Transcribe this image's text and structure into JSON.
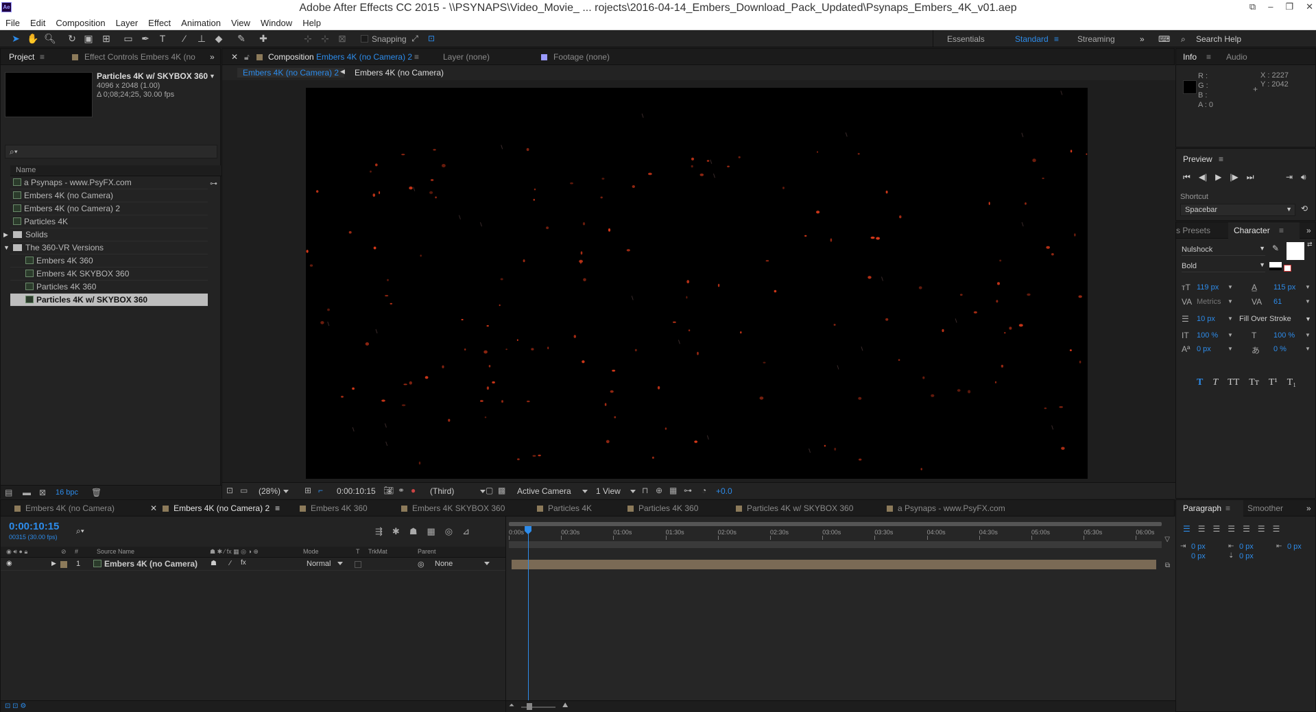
{
  "app": {
    "title": "Adobe After Effects CC 2015 - \\\\PSYNAPS\\Video_Movie_ ... rojects\\2016-04-14_Embers_Download_Pack_Updated\\Psynaps_Embers_4K_v01.aep",
    "logo": "Ae"
  },
  "menu": [
    "File",
    "Edit",
    "Composition",
    "Layer",
    "Effect",
    "Animation",
    "View",
    "Window",
    "Help"
  ],
  "toolbar": {
    "snapping_label": "Snapping",
    "workspaces": [
      "Essentials",
      "Standard",
      "Streaming"
    ],
    "active_workspace": "Standard",
    "search_help": "Search Help"
  },
  "project": {
    "tab": "Project",
    "effect_controls_tab": "Effect Controls Embers 4K (no",
    "selected_name": "Particles 4K w/ SKYBOX 360",
    "selected_dims": "4096 x 2048 (1.00)",
    "selected_duration": "Δ 0;08;24;25, 30.00 fps",
    "search_placeholder": "",
    "name_header": "Name",
    "items": [
      {
        "label": "a Psynaps - www.PsyFX.com",
        "type": "comp",
        "indent": 0
      },
      {
        "label": "Embers 4K (no Camera)",
        "type": "comp",
        "indent": 0
      },
      {
        "label": "Embers 4K (no Camera) 2",
        "type": "comp",
        "indent": 0
      },
      {
        "label": "Particles 4K",
        "type": "comp",
        "indent": 0
      },
      {
        "label": "Solids",
        "type": "folder",
        "indent": 0,
        "expanded": false
      },
      {
        "label": "The 360-VR Versions",
        "type": "folder",
        "indent": 0,
        "expanded": true
      },
      {
        "label": "Embers 4K 360",
        "type": "comp",
        "indent": 1
      },
      {
        "label": "Embers 4K SKYBOX 360",
        "type": "comp",
        "indent": 1
      },
      {
        "label": "Particles 4K 360",
        "type": "comp",
        "indent": 1
      },
      {
        "label": "Particles 4K w/ SKYBOX 360",
        "type": "comp",
        "indent": 1,
        "selected": true
      }
    ],
    "bpc": "16 bpc"
  },
  "composition": {
    "tab_prefix": "Composition",
    "tab_name": "Embers 4K (no Camera) 2",
    "layer_tab": "Layer (none)",
    "footage_tab": "Footage (none)",
    "breadcrumb": [
      "Embers 4K (no Camera) 2",
      "Embers 4K (no Camera)"
    ],
    "zoom": "(28%)",
    "timecode": "0:00:10:15",
    "resolution": "(Third)",
    "camera": "Active Camera",
    "views": "1 View",
    "exposure": "+0.0"
  },
  "info": {
    "tab": "Info",
    "audio_tab": "Audio",
    "r": "R :",
    "g": "G :",
    "b": "B :",
    "a": "A : 0",
    "x": "X : 2227",
    "y": "Y : 2042"
  },
  "preview": {
    "title": "Preview",
    "shortcut_label": "Shortcut",
    "shortcut_value": "Spacebar"
  },
  "character": {
    "presets_tab": "s Presets",
    "tab": "Character",
    "font": "Nulshock",
    "style": "Bold",
    "size": "119 px",
    "leading": "115 px",
    "kerning": "Metrics",
    "tracking": "61",
    "stroke_width": "10 px",
    "stroke_type": "Fill Over Stroke",
    "vscale": "100 %",
    "hscale": "100 %",
    "baseline": "0 px",
    "tsume": "0 %",
    "type_buttons": [
      "T",
      "T",
      "TT",
      "Tт",
      "T¹",
      "T₁"
    ]
  },
  "paragraph": {
    "tab": "Paragraph",
    "smoother_tab": "Smoother",
    "indent_left": "0 px",
    "indent_first": "0 px",
    "indent_right": "0 px",
    "space_before": "0 px",
    "space_after": "0 px"
  },
  "timeline": {
    "tabs": [
      "Embers 4K (no Camera)",
      "Embers 4K (no Camera) 2",
      "Embers 4K 360",
      "Embers 4K SKYBOX 360",
      "Particles 4K",
      "Particles 4K 360",
      "Particles 4K w/ SKYBOX 360",
      "a Psynaps - www.PsyFX.com"
    ],
    "active_tab": "Embers 4K (no Camera) 2",
    "timecode": "0:00:10:15",
    "frame_info": "00315 (30.00 fps)",
    "col_source": "Source Name",
    "col_mode": "Mode",
    "col_t": "T",
    "col_trkmat": "TrkMat",
    "col_parent": "Parent",
    "col_num": "#",
    "ruler": [
      "0:00s",
      "00:30s",
      "01:00s",
      "01:30s",
      "02:00s",
      "02:30s",
      "03:00s",
      "03:30s",
      "04:00s",
      "04:30s",
      "05:00s",
      "05:30s",
      "06:00s"
    ],
    "layers": [
      {
        "num": "1",
        "name": "Embers 4K (no Camera)",
        "mode": "Normal",
        "parent": "None"
      }
    ],
    "playhead_fraction": 0.0295
  },
  "colors": {
    "accent": "#2d8ceb",
    "viewer_bg": "#000000",
    "layer_bar": "#7a6a55",
    "ember": "#d8391a"
  }
}
